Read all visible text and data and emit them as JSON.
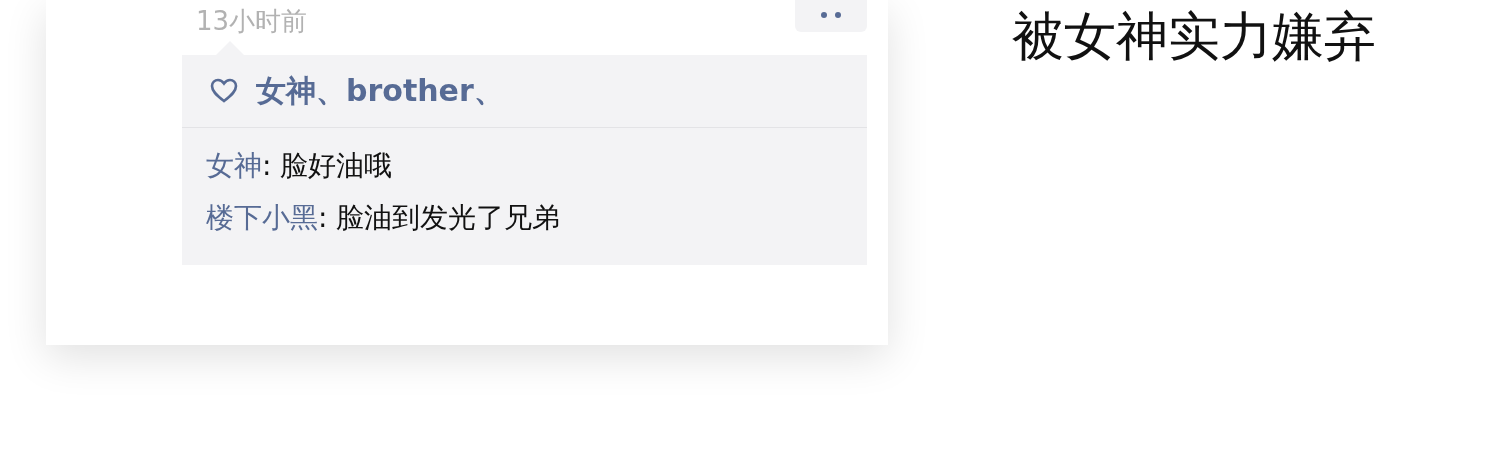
{
  "post": {
    "time": "13小时前",
    "likes": {
      "names": "女神、brother、"
    },
    "comments": [
      {
        "author": "女神",
        "text": ": 脸好油哦"
      },
      {
        "author": "楼下小黑",
        "text": ": 脸油到发光了兄弟"
      }
    ]
  },
  "caption": "被女神实力嫌弃"
}
